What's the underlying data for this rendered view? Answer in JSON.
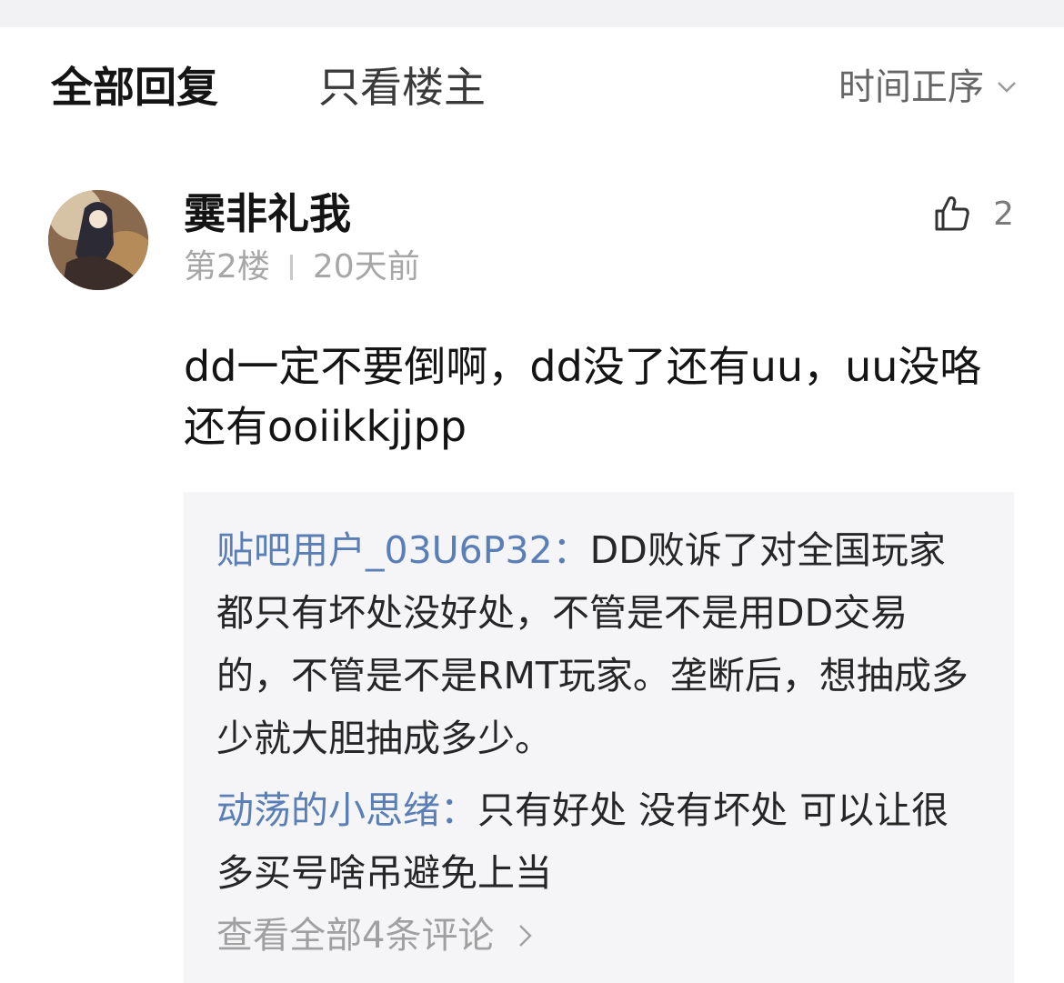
{
  "tabs": {
    "all_replies": "全部回复",
    "owner_only": "只看楼主",
    "sort_label": "时间正序"
  },
  "post": {
    "username": "霙非礼我",
    "floor": "第2楼",
    "time": "20天前",
    "like_count": "2",
    "content": "dd一定不要倒啊，dd没了还有uu，uu没咯还有ooiikkjjpp"
  },
  "replies": [
    {
      "author": "贴吧用户_03U6P32：",
      "text": "DD败诉了对全国玩家都只有坏处没好处，不管是不是用DD交易的，不管是不是RMT玩家。垄断后，想抽成多少就大胆抽成多少。"
    },
    {
      "author": "动荡的小思绪：",
      "text": "只有好处 没有坏处 可以让很多买号啥吊避免上当"
    }
  ],
  "view_all": "查看全部4条评论",
  "colors": {
    "accent_link": "#5a7fb6",
    "muted": "#a7a7a7",
    "reply_bg": "#f5f5f7"
  },
  "icons": [
    "chevron-down-icon",
    "thumbs-up-icon",
    "chevron-right-icon"
  ]
}
